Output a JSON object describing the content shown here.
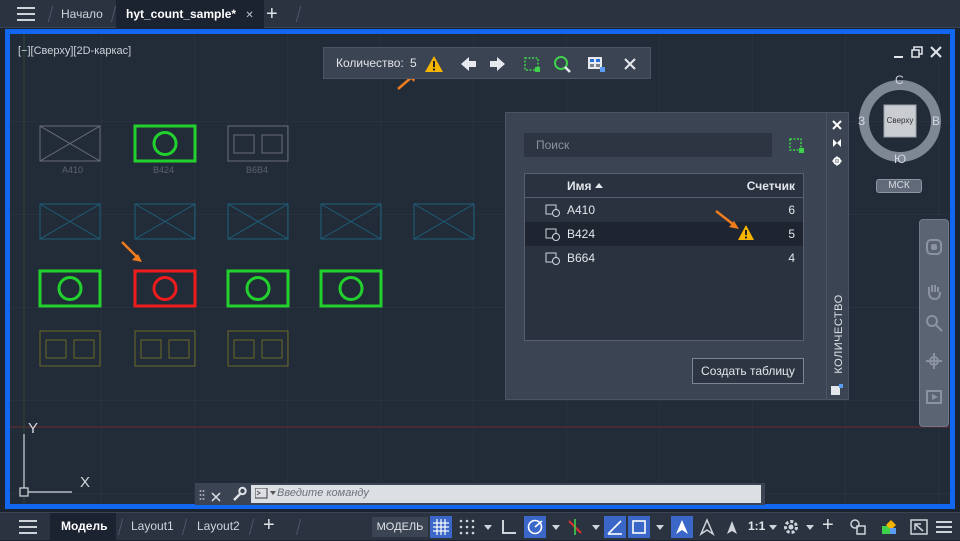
{
  "tabs": {
    "home": "Начало",
    "active": "hyt_count_sample*",
    "close_glyph": "✕",
    "add_glyph": "+"
  },
  "view_label": "[−][Сверху][2D-каркас]",
  "count_toolbar": {
    "label": "Количество:",
    "value": "5"
  },
  "blocks": {
    "labels": [
      "A410",
      "B424",
      "B6B4"
    ]
  },
  "panel": {
    "search_placeholder": "Поиск",
    "columns": {
      "name": "Имя",
      "count": "Счетчик"
    },
    "rows": [
      {
        "name": "A410",
        "count": "6",
        "warning": false
      },
      {
        "name": "B424",
        "count": "5",
        "warning": true
      },
      {
        "name": "B664",
        "count": "4",
        "warning": false
      }
    ],
    "create_button": "Создать таблицу",
    "side_title": "КОЛИЧЕСТВО"
  },
  "viewcube": {
    "north": "С",
    "south": "Ю",
    "west": "З",
    "east": "В",
    "face": "Сверху",
    "ucs": "МСК"
  },
  "axis": {
    "y": "Y",
    "x": "X"
  },
  "command": {
    "placeholder": "Введите команду"
  },
  "status": {
    "model_tab": "Модель",
    "layout1": "Layout1",
    "layout2": "Layout2",
    "model_button": "МОДЕЛЬ",
    "scale": "1:1"
  },
  "colors": {
    "accent_blue": "#1167f0",
    "warning": "#f5b400",
    "arrow": "#f07c1e",
    "block_green": "#22d12e",
    "block_red": "#ee1c1c",
    "block_gray": "#6a6f78",
    "block_cyan": "#1d5f7a",
    "block_olive": "#6b6a24"
  }
}
